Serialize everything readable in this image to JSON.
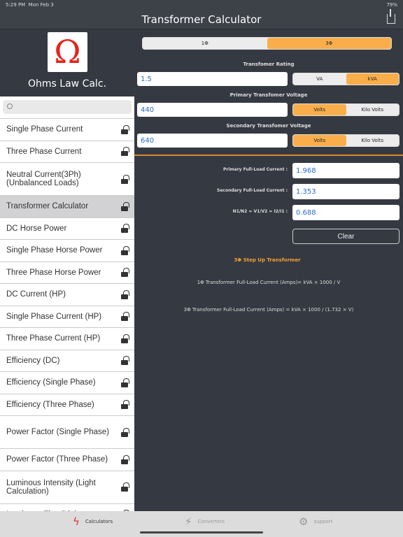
{
  "status": {
    "time": "5:29 PM",
    "date": "Mon Feb 3",
    "battery": "79%"
  },
  "nav": {
    "title": "Transformer Calculator"
  },
  "sidebar": {
    "app_name": "Ohms Law Calc.",
    "logo_symbol": "Ω",
    "search_placeholder": "",
    "items": [
      {
        "label": "Single Phase Current"
      },
      {
        "label": "Three Phase Current"
      },
      {
        "label": "Neutral Current(3Ph) (Unbalanced Loads)"
      },
      {
        "label": "Transformer Calculator",
        "selected": true
      },
      {
        "label": "DC Horse Power"
      },
      {
        "label": "Single Phase Horse Power"
      },
      {
        "label": "Three Phase Horse Power"
      },
      {
        "label": "DC Current (HP)"
      },
      {
        "label": "Single Phase Current (HP)"
      },
      {
        "label": "Three Phase Current (HP)"
      },
      {
        "label": "Efficiency (DC)"
      },
      {
        "label": "Efficiency (Single Phase)"
      },
      {
        "label": "Efficiency (Three Phase)"
      },
      {
        "label": "Power Factor (Single Phase)"
      },
      {
        "label": "Power Factor (Three Phase)"
      },
      {
        "label": "Luminous Intensity (Light Calculation)"
      },
      {
        "label": "Luminous Flux (Light"
      }
    ]
  },
  "main": {
    "phase": {
      "options": [
        "1Φ",
        "3Φ"
      ],
      "selected": "3Φ"
    },
    "rating": {
      "label": "Transfomer Rating",
      "value": "1.5",
      "units": [
        "VA",
        "kVA"
      ],
      "selected": "kVA"
    },
    "primary": {
      "label": "Primary Transfomer Voltage",
      "value": "440",
      "units": [
        "Volts",
        "Kilo Volts"
      ],
      "selected": "Volts"
    },
    "secondary": {
      "label": "Secondary Transfomer Voltage",
      "value": "640",
      "units": [
        "Volts",
        "Kilo Volts"
      ],
      "selected": "Volts"
    },
    "results": [
      {
        "label": "Primary Full-Load Current :",
        "value": "1.968"
      },
      {
        "label": "Secondary Full-Load Current :",
        "value": "1.353"
      },
      {
        "label": "N1/N2 = V1/V2 = I2/I1 :",
        "value": "0.688"
      }
    ],
    "clear_label": "Clear",
    "type_text": "3Φ Step Up Transformer",
    "formula1": "1Φ Transformer Full-Load Current (Amps)= kVA × 1000 / V",
    "formula3": "3Φ Transformer Full-Load Current (Amps) = kVA × 1000 / (1.732 × V)",
    "accent": "#f9ae4b"
  },
  "tabbar": {
    "items": [
      {
        "label": "Calculators",
        "icon": "bolt-icon"
      },
      {
        "label": "Converters",
        "icon": "bolt-circle-icon"
      },
      {
        "label": "support",
        "icon": "gear-icon"
      }
    ]
  }
}
